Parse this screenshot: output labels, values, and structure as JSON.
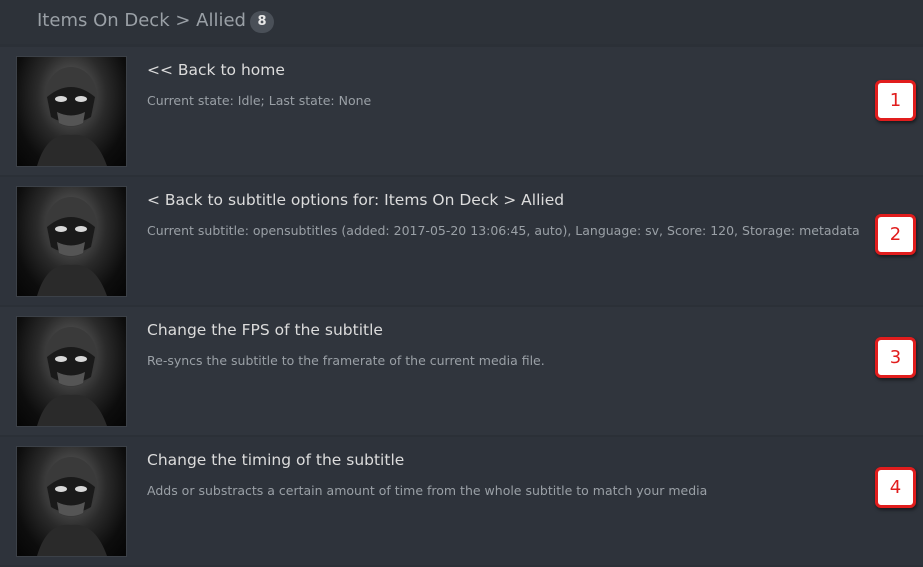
{
  "header": {
    "title": "Items On Deck > Allied",
    "count": "8"
  },
  "items": [
    {
      "title": "<< Back to home",
      "description": "Current state: Idle; Last state: None",
      "callout": "1"
    },
    {
      "title": "< Back to subtitle options for: Items On Deck > Allied",
      "description": "Current subtitle: opensubtitles (added: 2017-05-20 13:06:45, auto), Language: sv, Score: 120, Storage: metadata",
      "callout": "2"
    },
    {
      "title": "Change the FPS of the subtitle",
      "description": "Re-syncs the subtitle to the framerate of the current media file.",
      "callout": "3"
    },
    {
      "title": "Change the timing of the subtitle",
      "description": "Adds or substracts a certain amount of time from the whole subtitle to match your media",
      "callout": "4"
    }
  ],
  "colors": {
    "background": "#2b3037",
    "callout_border": "#e11d1d",
    "callout_fill": "#ffffff",
    "title_text": "#dcdcdc",
    "description_text": "#9aa0a6"
  },
  "icons": {
    "thumbnail": "masked-ninja-thumbnail"
  }
}
